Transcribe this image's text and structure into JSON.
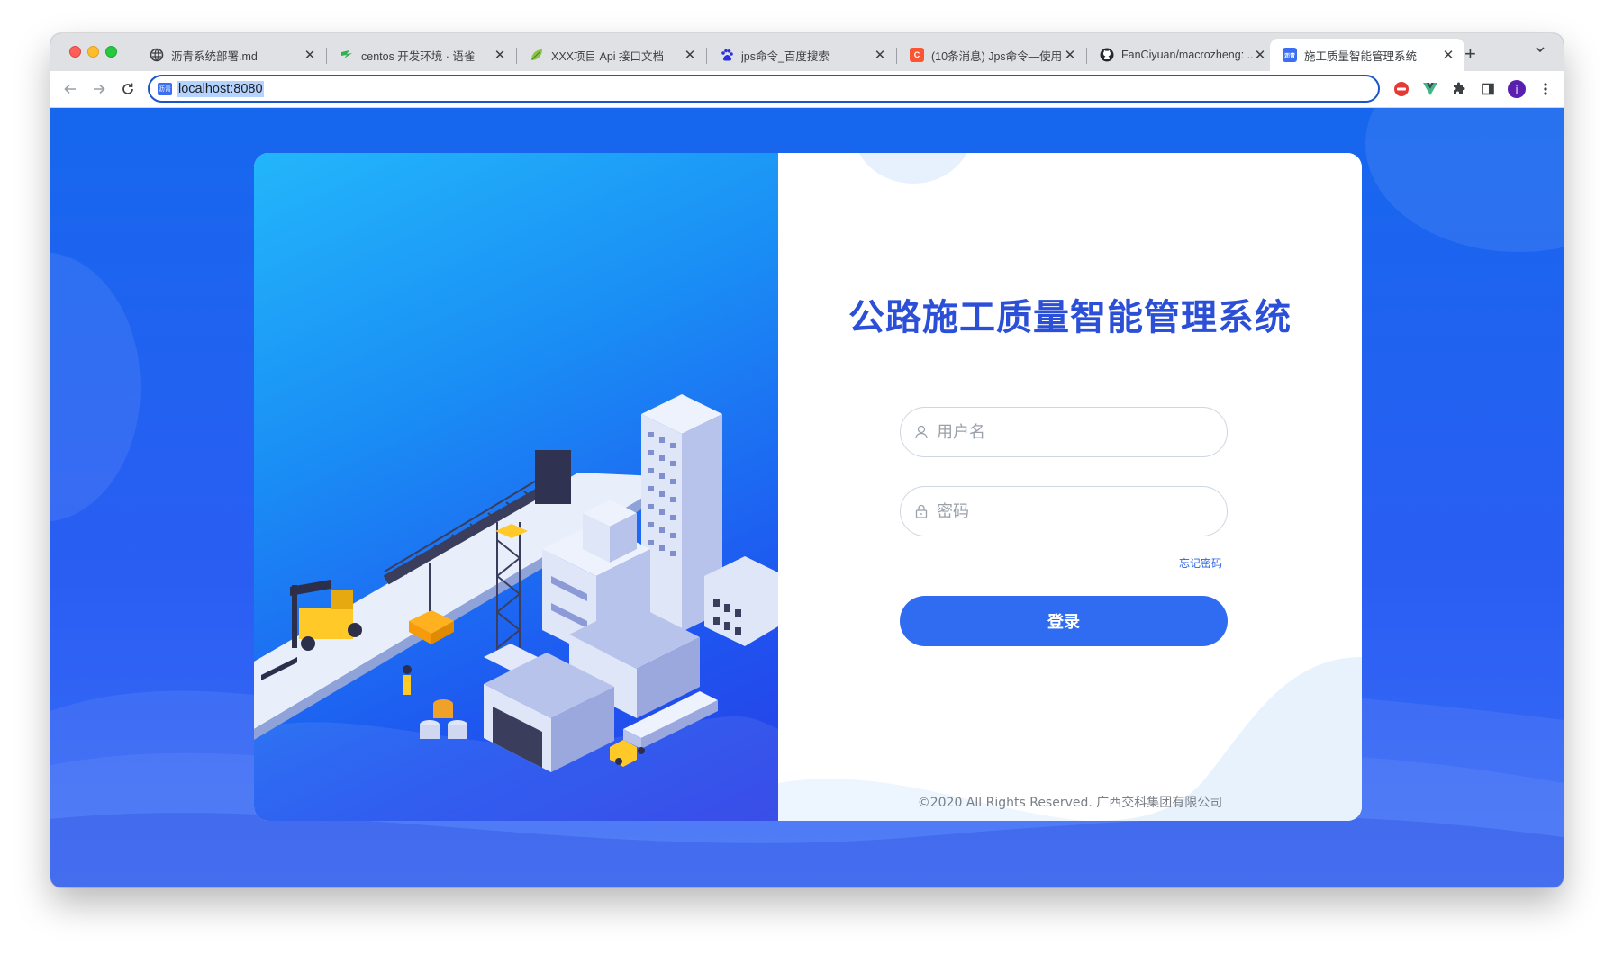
{
  "browser": {
    "tabs": [
      {
        "title": "沥青系统部署.md",
        "icon": "globe-icon",
        "color": "#3c4043"
      },
      {
        "title": "centos 开发环境 · 语雀",
        "icon": "yuque-icon",
        "color": "#31b14f"
      },
      {
        "title": "XXX项目 Api 接口文档",
        "icon": "leaf-icon",
        "color": "#6cae34"
      },
      {
        "title": "jps命令_百度搜索",
        "icon": "baidu-paw-icon",
        "color": "#2932e1"
      },
      {
        "title": "(10条消息) Jps命令—使用...",
        "icon": "csdn-icon",
        "color": "#fc5531"
      },
      {
        "title": "FanCiyuan/macrozheng: ...",
        "icon": "github-icon",
        "color": "#24292f"
      },
      {
        "title": "施工质量智能管理系统",
        "icon": "site-icon",
        "color": "#3b6ff3"
      }
    ],
    "active_tab": 6,
    "url": "localhost:8080",
    "favicon_text": "沥青"
  },
  "login": {
    "title": "公路施工质量智能管理系统",
    "username_placeholder": "用户名",
    "password_placeholder": "密码",
    "forgot_label": "忘记密码",
    "login_label": "登录",
    "copyright": "©2020 All Rights Reserved. 广西交科集团有限公司"
  },
  "colors": {
    "brand": "#2b4fd6",
    "button": "#2f6cf1",
    "page_bg": "#1e63f0"
  }
}
